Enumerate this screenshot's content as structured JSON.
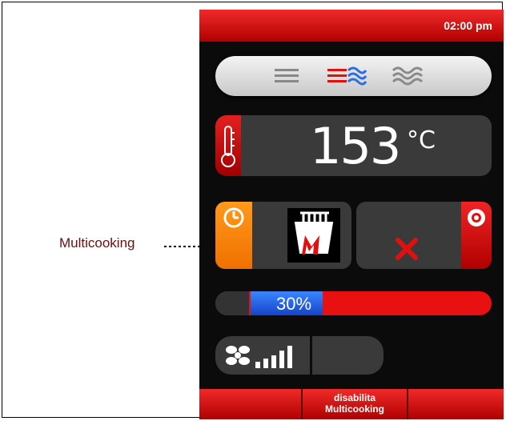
{
  "callout": {
    "label": "Multicooking"
  },
  "status": {
    "time": "02:00 pm"
  },
  "temperature": {
    "value": "153",
    "unit": "°C"
  },
  "progress": {
    "percent": 30,
    "label": "30%"
  },
  "bottom_buttons": [
    {
      "label_line1": "disabilita",
      "label_line2": "Multicooking"
    }
  ],
  "colors": {
    "accent_red": "#e01010",
    "timer_orange": "#f68a0a",
    "progress_blue": "#2a64e6"
  },
  "icons": {
    "mode_static": "static-heat-icon",
    "mode_convection": "convection-heat-icon",
    "mode_humid": "humidity-heat-icon",
    "thermometer": "thermometer-icon",
    "clock": "clock-icon",
    "multicooking": "multicooking-icon",
    "cancel": "cancel-x-icon",
    "record": "record-icon",
    "fan": "fan-icon",
    "fan_speed": "fan-speed-bars-icon"
  }
}
